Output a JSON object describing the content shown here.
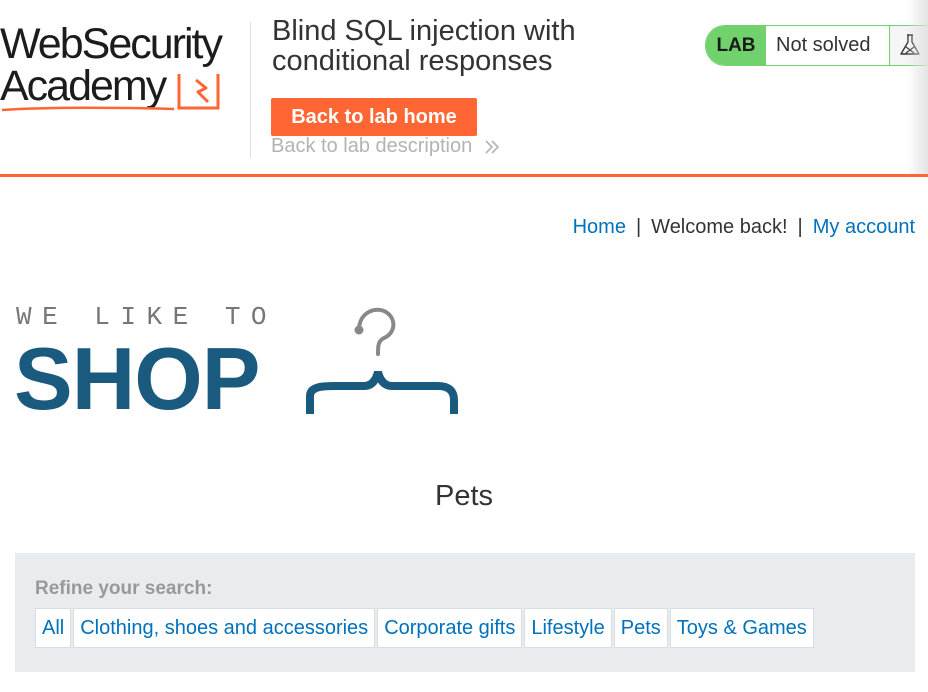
{
  "header": {
    "logo": {
      "line1": "WebSecurity",
      "line2": "Academy"
    },
    "lab_title": "Blind SQL injection with conditional responses",
    "back_home_label": "Back to lab home",
    "back_desc_label": "Back to lab description",
    "status": {
      "badge": "LAB",
      "text": "Not solved"
    }
  },
  "nav": {
    "home": "Home",
    "separator": "|",
    "welcome": "Welcome back!",
    "my_account": "My account"
  },
  "shop": {
    "tagline": "WE LIKE TO",
    "brand": "SHOP"
  },
  "category": {
    "title": "Pets"
  },
  "filters": {
    "label": "Refine your search:",
    "items": [
      "All",
      "Clothing, shoes and accessories",
      "Corporate gifts",
      "Lifestyle",
      "Pets",
      "Toys & Games"
    ]
  },
  "colors": {
    "accent_orange": "#ff6633",
    "lab_green": "#70d16d",
    "link_blue": "#0071bc",
    "shop_brand_blue": "#1b5a7f"
  }
}
